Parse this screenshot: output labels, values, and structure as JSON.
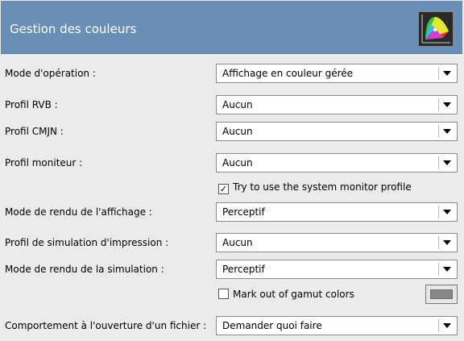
{
  "header": {
    "title": "Gestion des couleurs",
    "icon": "color-gamut-icon"
  },
  "rows": {
    "mode_operation": {
      "label": "Mode d'opération :",
      "value": "Affichage en couleur gérée"
    },
    "profil_rvb": {
      "label": "Profil RVB :",
      "value": "Aucun"
    },
    "profil_cmjn": {
      "label": "Profil CMJN :",
      "value": "Aucun"
    },
    "profil_moniteur": {
      "label": "Profil moniteur :",
      "value": "Aucun"
    },
    "system_monitor": {
      "label": "Try to use the system monitor profile",
      "checked": true
    },
    "mode_rendu_affichage": {
      "label": "Mode de rendu de l'affichage :",
      "value": "Perceptif"
    },
    "profil_simulation": {
      "label": "Profil de simulation d'impression :",
      "value": "Aucun"
    },
    "mode_rendu_simulation": {
      "label": "Mode de rendu de la simulation :",
      "value": "Perceptif"
    },
    "gamut": {
      "label": "Mark out of gamut colors",
      "checked": false,
      "color": "#888888"
    },
    "comportement": {
      "label": "Comportement à l'ouverture d'un fichier :",
      "value": "Demander quoi faire"
    }
  }
}
